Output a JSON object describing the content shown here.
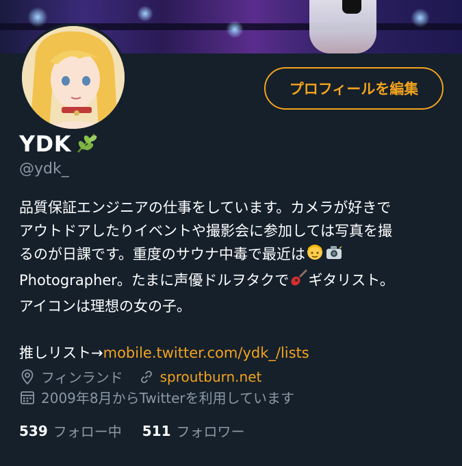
{
  "profile": {
    "edit_button_label": "プロフィールを編集",
    "name": "YDK",
    "handle": "@ydk_"
  },
  "bio": {
    "line1": "品質保証エンジニアの仕事をしています。カメラが好きで",
    "line2": "アウトドアしたりイベントや撮影会に参加しては写真を撮",
    "line3": "るのが日課です。重度のサウナ中毒で最近は",
    "line4_a": "Photographer。たまに声優ドルヲタクで",
    "line4_b": "ギタリスト。",
    "line5": "アイコンは理想の女の子。",
    "lists_prefix": "推しリスト→",
    "lists_link": "mobile.twitter.com/ydk_/lists"
  },
  "meta": {
    "location": "フィンランド",
    "website": "sproutburn.net",
    "joined": "2009年8月からTwitterを利用しています"
  },
  "stats": {
    "following_count": "539",
    "following_label": "フォロー中",
    "followers_count": "511",
    "followers_label": "フォロワー"
  },
  "colors": {
    "background": "#15202b",
    "accent": "#f4a31e",
    "secondary_text": "#8b98a5"
  },
  "icons": [
    "leaf-icon",
    "location-pin-icon",
    "link-icon",
    "calendar-icon",
    "person-emoji-icon",
    "camera-emoji-icon",
    "guitar-emoji-icon"
  ]
}
